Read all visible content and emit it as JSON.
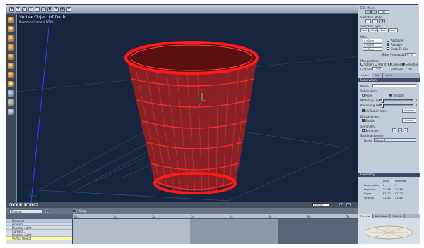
{
  "viewport": {
    "title": "Vertex Object of Dach",
    "camera": "Director's Camera 100%"
  },
  "toolbar": {
    "icons": [
      "move-icon",
      "rotate-icon",
      "scale-icon",
      "select-icon",
      "lasso-icon",
      "zoom-icon",
      "render-icon",
      "light-icon",
      "camera-icon",
      "grid-icon"
    ]
  },
  "timeline": {
    "playing_label": "Playing",
    "snap_label": "Snap",
    "ruler_ticks": [
      "0s",
      "1s",
      "2s",
      "3s",
      "4s",
      "5s",
      "6s",
      "7s"
    ],
    "tracks": [
      "Universe",
      "Ground",
      "Director Light",
      "Camera 1",
      "Director Light",
      "Vertex Object"
    ],
    "selected_track_index": 0,
    "highlighted_track_index": 5,
    "frame_value": "0:00:00"
  },
  "right_panel": {
    "edit_mode_label": "Edit Mode",
    "selection_mode_label": "Selection Mode",
    "selection_type_label": "Selection Type",
    "selection_type_buttons": [
      "Loop",
      "Ring",
      "Box",
      "Invert"
    ],
    "move_label": "Move",
    "move_values": [
      "0.00 cm",
      "0.00 cm",
      "0.00 cm"
    ],
    "absolute_label": "Absolute",
    "relative_label": "Relative",
    "snap_to_grid_label": "Snap To Grid",
    "edge_propagation_label": "Edge Propagation",
    "edge_propagation_value": "50.00",
    "manipulation_label": "Manipulation",
    "manipulation_options": [
      "Screen",
      "World",
      "Camera",
      "Selection"
    ],
    "grid_size_label": "Grid Size",
    "grid_size_value": "1.000",
    "softness_label": "Softness",
    "softness_value": "0%",
    "tabs": [
      "Model",
      "Mat",
      "Anim"
    ],
    "subdivision_head": "Subdivision",
    "name_label": "Name",
    "smooth_label": "Subdivision",
    "smooth_options": [
      "None",
      "Smooth"
    ],
    "modeling_level_label": "Modeling Level",
    "rendering_level_label": "Rendering Level",
    "modeling_level_value": "1",
    "rendering_level_value": "1",
    "uv_subdivision_label": "UV Subdivision",
    "convert_label": "Convert",
    "displacement_label": "Displacement",
    "enable_label": "Enable",
    "create_label": "Create",
    "symmetry_label": "Symmetry",
    "symmetry_check_label": "Symmetry",
    "shading_domain_label": "Shading domain",
    "shading_name_label": "Name",
    "shading_name_value": "Object 1",
    "geometry_head": "Geometry",
    "stats_headers": [
      "",
      "Total",
      "Selected"
    ],
    "stats_rows": [
      [
        "Polymeshes",
        "1",
        "1"
      ],
      [
        "Polygons",
        "31388",
        "31388"
      ],
      [
        "Edges",
        "62720",
        "62720"
      ],
      [
        "Vertices",
        "31362",
        "31362"
      ]
    ],
    "preview_tabs": [
      "Preview",
      "Animation",
      "Objects"
    ]
  },
  "colors": {
    "viewport_bg": "#16253d",
    "wireframe": "#ff1a1a",
    "panel_bg": "#c3ccd9"
  }
}
